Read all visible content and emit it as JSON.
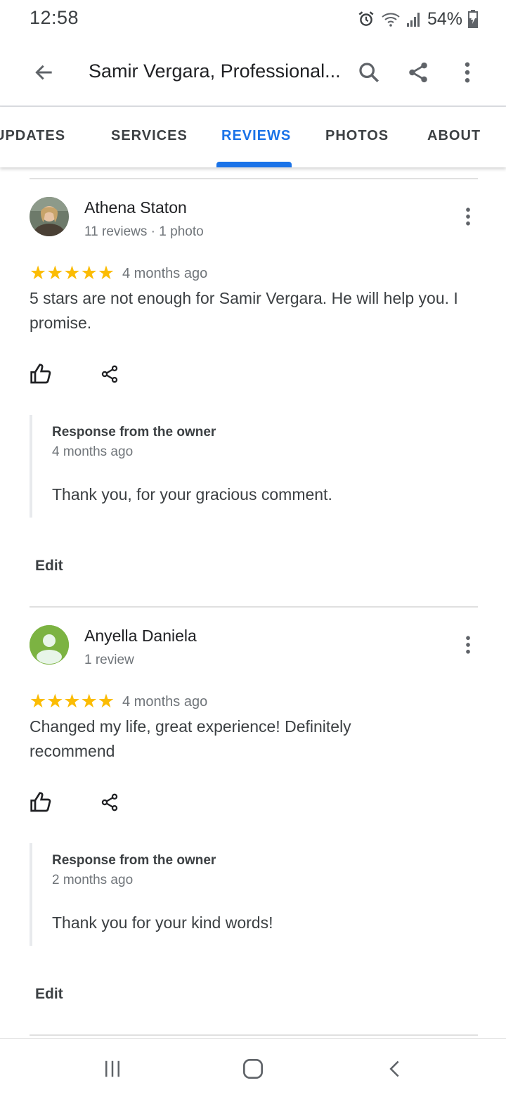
{
  "status_bar": {
    "time": "12:58",
    "battery": "54%",
    "icons": [
      "alarm-icon",
      "wifi-icon",
      "signal-icon",
      "battery-icon"
    ]
  },
  "app_bar": {
    "title": "Samir Vergara, Professional...",
    "icons": [
      "back-arrow-icon",
      "search-icon",
      "share-icon",
      "more-vert-icon"
    ]
  },
  "tabs": {
    "updates": "UPDATES",
    "services": "SERVICES",
    "reviews": "REVIEWS",
    "photos": "PHOTOS",
    "about": "ABOUT",
    "active": "REVIEWS"
  },
  "reviews": [
    {
      "name": "Athena Staton",
      "meta": "11 reviews · 1 photo",
      "rating": 5,
      "stars": "★★★★★",
      "date": "4 months ago",
      "text": "5 stars are not enough for Samir Vergara. He will help you. I promise.",
      "response": {
        "title": "Response from the owner",
        "date": "4 months ago",
        "text": "Thank you, for your gracious comment."
      },
      "edit_label": "Edit"
    },
    {
      "name": "Anyella Daniela",
      "meta": "1 review",
      "rating": 5,
      "stars": "★★★★★",
      "date": "4 months ago",
      "text": "Changed my life, great experience! Definitely recommend",
      "response": {
        "title": "Response from the owner",
        "date": "2 months ago",
        "text": "Thank you for your kind words!"
      },
      "edit_label": "Edit"
    }
  ],
  "colors": {
    "accent": "#1a73e8",
    "star": "#fbbc04",
    "avatar_default": "#7cb342"
  }
}
